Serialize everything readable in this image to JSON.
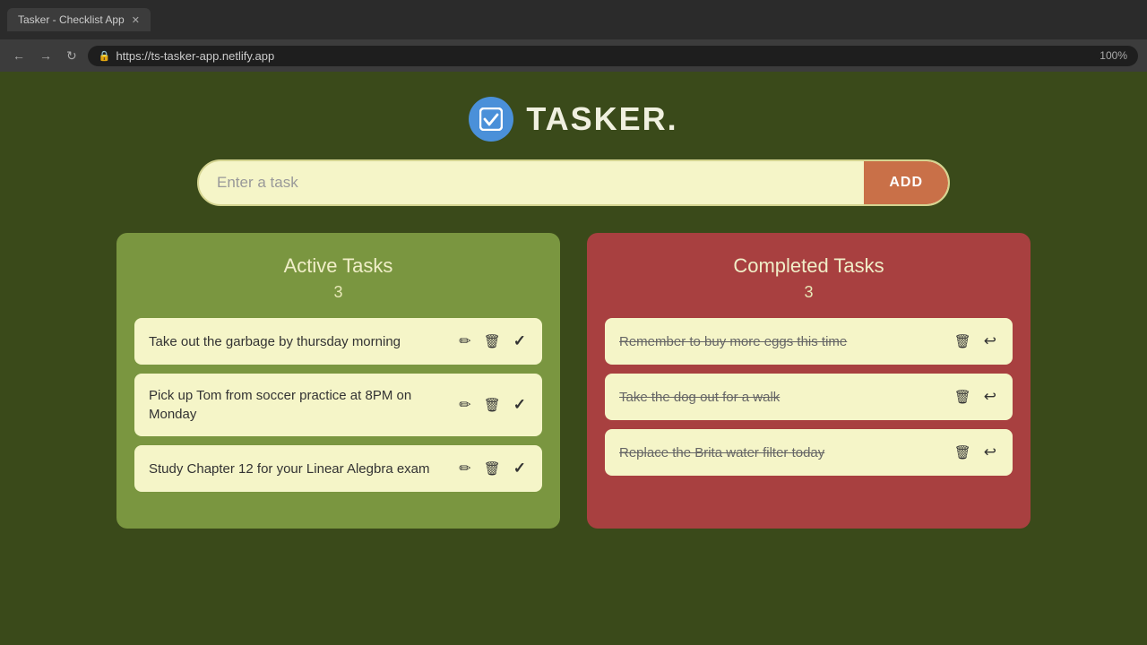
{
  "browser": {
    "tab_title": "Tasker - Checklist App",
    "url": "https://ts-tasker-app.netlify.app",
    "zoom": "100%"
  },
  "header": {
    "title": "TASKER.",
    "logo_icon": "✓"
  },
  "input": {
    "placeholder": "Enter a task",
    "add_button_label": "ADD"
  },
  "active_tasks": {
    "title": "Active Tasks",
    "count": "3",
    "items": [
      {
        "id": "active-1",
        "text": "Take out the garbage by thursday morning"
      },
      {
        "id": "active-2",
        "text": "Pick up Tom from soccer practice at 8PM on Monday"
      },
      {
        "id": "active-3",
        "text": "Study Chapter 12 for your Linear Alegbra exam"
      }
    ]
  },
  "completed_tasks": {
    "title": "Completed Tasks",
    "count": "3",
    "items": [
      {
        "id": "completed-1",
        "text": "Remember to buy more eggs this time"
      },
      {
        "id": "completed-2",
        "text": "Take the dog out for a walk"
      },
      {
        "id": "completed-3",
        "text": "Replace the Brita water filter today"
      }
    ]
  },
  "actions": {
    "edit_label": "edit",
    "delete_label": "delete",
    "complete_label": "complete",
    "undo_label": "undo"
  }
}
